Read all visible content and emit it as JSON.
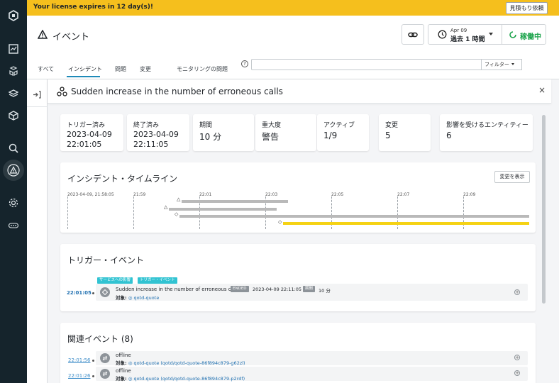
{
  "banner": {
    "text": "Your license expires in 12 day(s)!",
    "quote_button": "見積もり依頼"
  },
  "header": {
    "title": "イベント",
    "time_range_small": "Apr 09",
    "time_range_label": "過去 1 時間",
    "status_label": "稼働中"
  },
  "tabs": [
    "すべて",
    "インシデント",
    "問題",
    "変更",
    "モニタリングの問題"
  ],
  "filter": {
    "search_value": "",
    "filter_label": "フィルター"
  },
  "panel": {
    "title": "Sudden increase in the number of erroneous calls",
    "close": "×"
  },
  "stats": [
    {
      "label": "トリガー済み",
      "value": "2023-04-09",
      "value2": "22:01:05"
    },
    {
      "label": "終了済み",
      "value": "2023-04-09",
      "value2": "22:11:05"
    },
    {
      "label": "期間",
      "value": "10 分"
    },
    {
      "label": "重大度",
      "value": "警告"
    },
    {
      "label": "アクティブ",
      "value": "1/9"
    },
    {
      "label": "変更",
      "value": "5"
    },
    {
      "label": "影響を受けるエンティティー",
      "value": "6"
    }
  ],
  "timeline": {
    "title": "インシデント・タイムライン",
    "show_changes_button": "変更を表示",
    "ticks": [
      "2023-04-09, 21:58:05",
      "21:59",
      "22:01",
      "22:03",
      "22:05",
      "22:07",
      "22:09"
    ]
  },
  "trigger": {
    "title": "トリガー・イベント",
    "badges": [
      "サービスへの影響",
      "トリガー・イベント"
    ],
    "time": "22:01:05",
    "text": "Sudden increase in the number of erroneous calls",
    "ended_label": "ENDED",
    "ended_time": "2023-04-09 22:11:05",
    "duration_label": "期間",
    "duration_value": "10 分",
    "target_label": "対象:",
    "target_value": "qotd-quote"
  },
  "related": {
    "title": "関連イベント (8)",
    "events": [
      {
        "time": "22:01:56",
        "text": "offline",
        "target_label": "対象:",
        "target_value": "qotd-quote (qotd/qotd-quote-86f894c879-g62zl)"
      },
      {
        "time": "22:01:26",
        "text": "offline",
        "target_label": "対象:",
        "target_value": "qotd-quote (qotd/qotd-quote-86f894c879-p2rdf)"
      }
    ]
  },
  "colors": {
    "banner": "#f5bf1d",
    "sidebar": "#15242c",
    "accent": "#1e8ab8",
    "status_green": "#1aa34a",
    "timeline_yellow": "#f5d214",
    "badge_cyan": "#31c3d2"
  }
}
